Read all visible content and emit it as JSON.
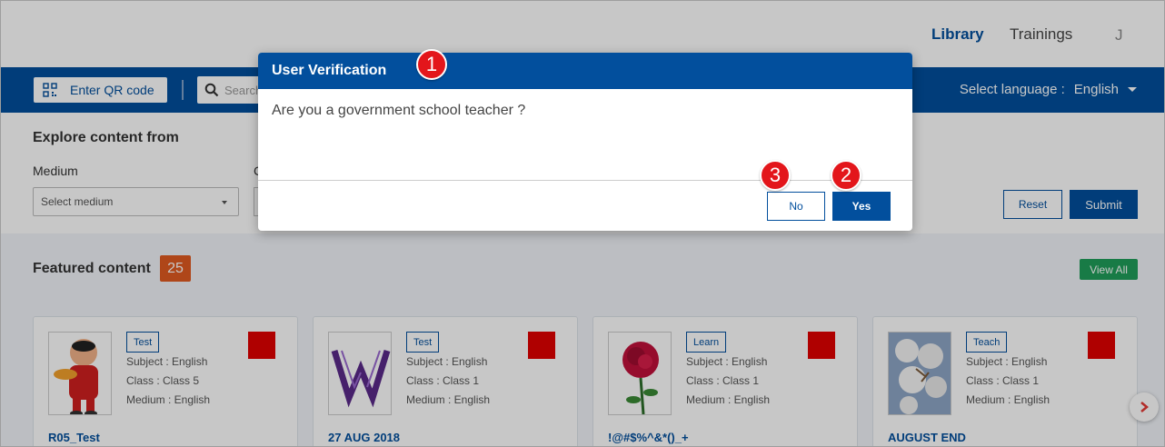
{
  "topnav": {
    "links": [
      "Library",
      "Trainings"
    ],
    "active": "Library",
    "user_initial": "J"
  },
  "toolbar": {
    "qr_label": "Enter QR code",
    "search_placeholder": "Search",
    "language_label": "Select language :",
    "language_value": "English"
  },
  "explore": {
    "title": "Explore content from",
    "medium_label": "Medium",
    "class_label_partial": "C",
    "medium_placeholder": "Select medium",
    "reset_label": "Reset",
    "submit_label": "Submit"
  },
  "featured": {
    "title": "Featured content",
    "count": "25",
    "view_all_label": "View All",
    "cards": [
      {
        "tag": "Test",
        "subject": "Subject : English",
        "class": "Class : Class 5",
        "medium": "Medium : English",
        "title": "R05_Test",
        "thumb": "cartoon"
      },
      {
        "tag": "Test",
        "subject": "Subject : English",
        "class": "Class : Class 1",
        "medium": "Medium : English",
        "title": "27 AUG 2018",
        "thumb": "logo"
      },
      {
        "tag": "Learn",
        "subject": "Subject : English",
        "class": "Class : Class 1",
        "medium": "Medium : English",
        "title": "!@#$%^&*()_+",
        "thumb": "rose"
      },
      {
        "tag": "Teach",
        "subject": "Subject : English",
        "class": "Class : Class 1",
        "medium": "Medium : English",
        "title": "AUGUST END",
        "thumb": "cotton"
      }
    ],
    "next_icon": "chevron-right-icon"
  },
  "modal": {
    "title": "User Verification",
    "question": "Are you a government school teacher ?",
    "no_label": "No",
    "yes_label": "Yes"
  },
  "markers": [
    "1",
    "2",
    "3"
  ],
  "colors": {
    "primary": "#024f9d",
    "badge": "#e05a21",
    "view_all": "#1f9e5a",
    "marker": "#e3161b"
  }
}
